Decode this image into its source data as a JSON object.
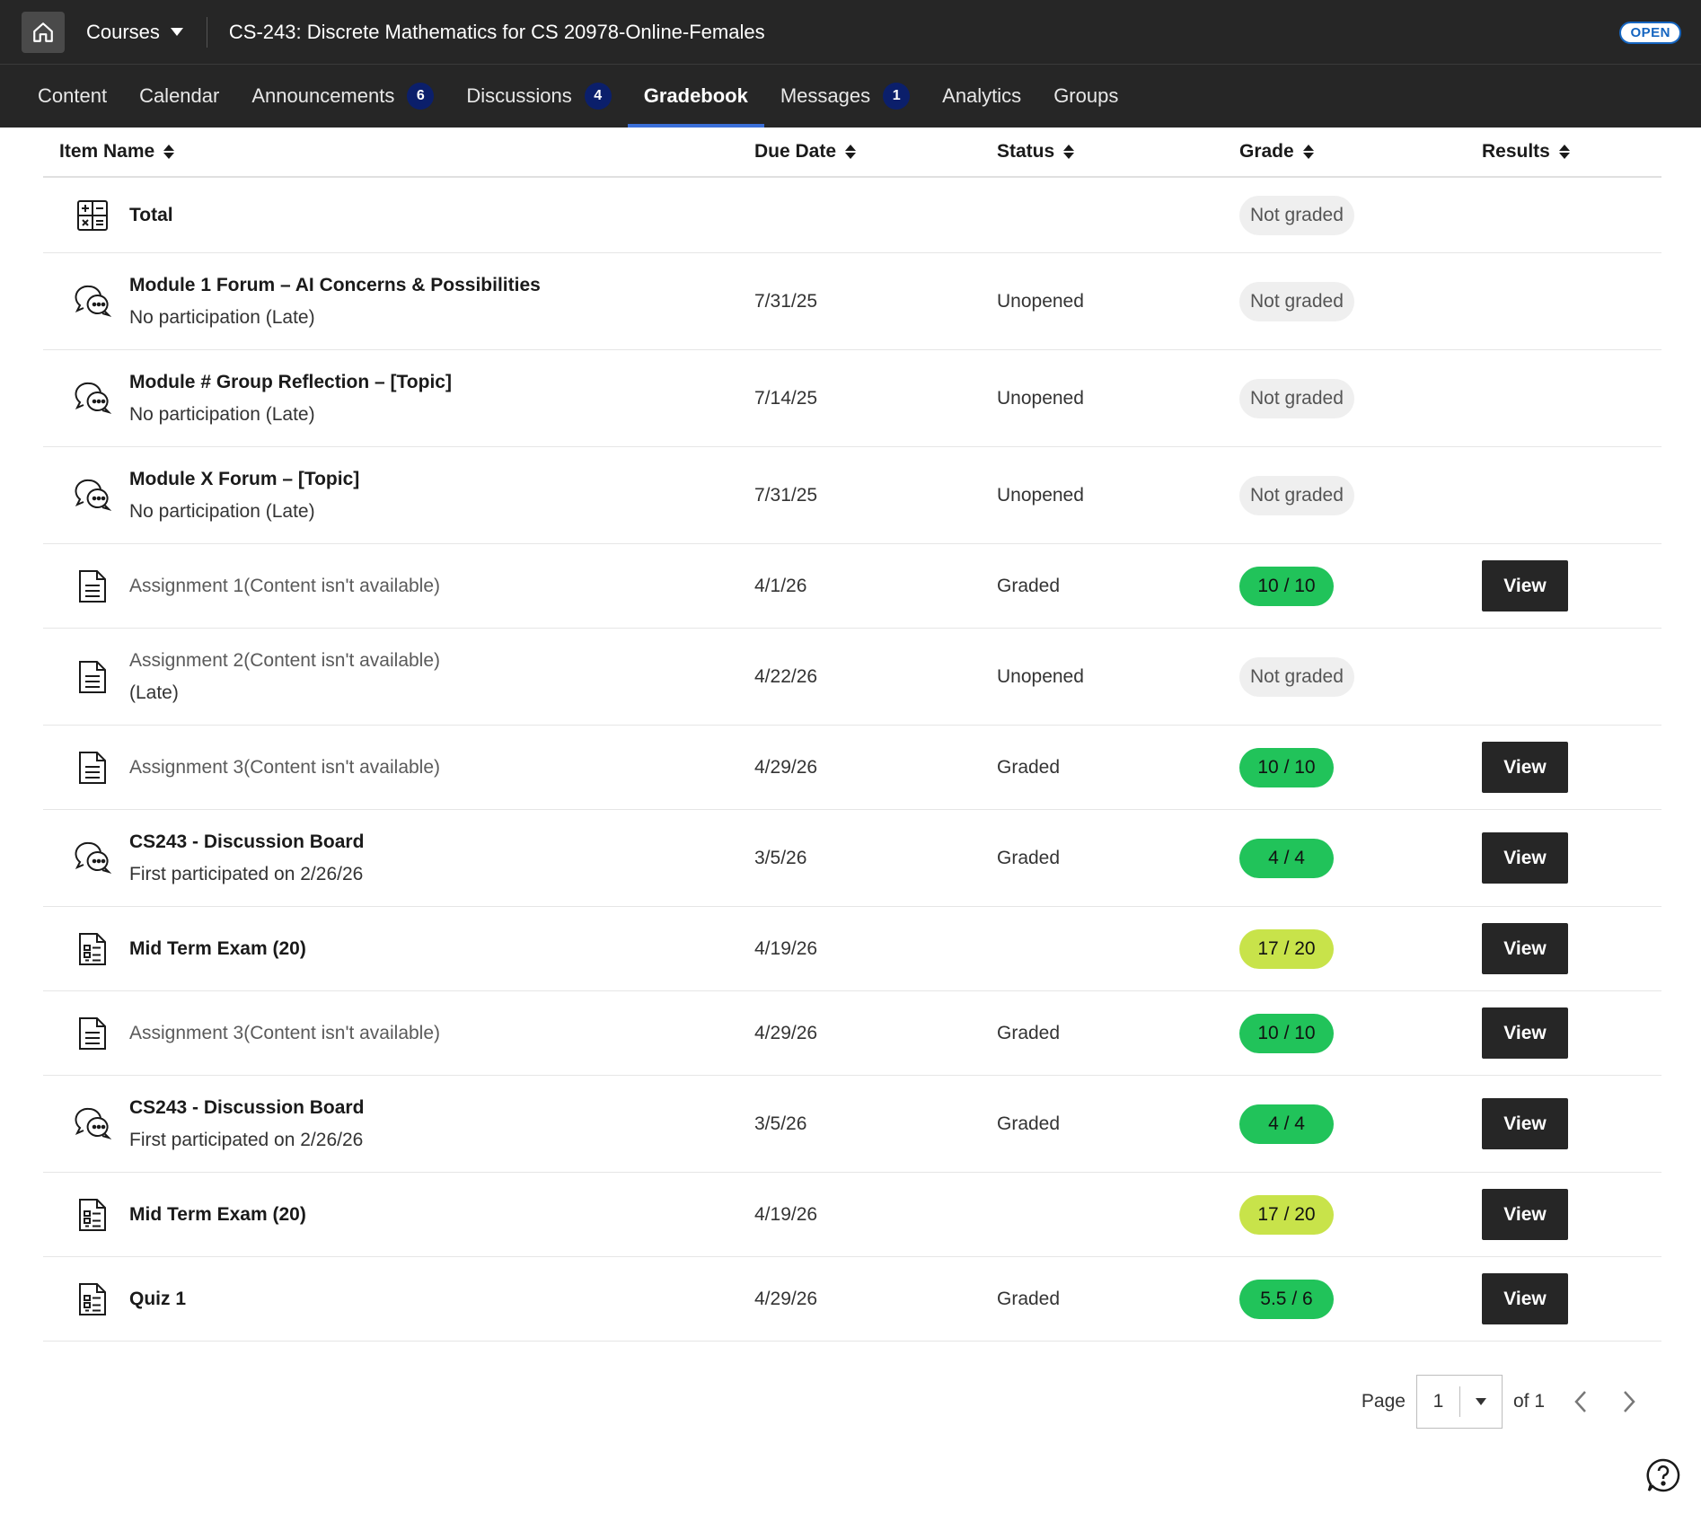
{
  "topbar": {
    "courses_label": "Courses",
    "course_title": "CS-243: Discrete Mathematics for CS 20978-Online-Females",
    "status_badge": "OPEN"
  },
  "nav": {
    "items": [
      {
        "label": "Content",
        "badge": ""
      },
      {
        "label": "Calendar",
        "badge": ""
      },
      {
        "label": "Announcements",
        "badge": "6"
      },
      {
        "label": "Discussions",
        "badge": "4"
      },
      {
        "label": "Gradebook",
        "badge": "",
        "active": true
      },
      {
        "label": "Messages",
        "badge": "1"
      },
      {
        "label": "Analytics",
        "badge": ""
      },
      {
        "label": "Groups",
        "badge": ""
      }
    ]
  },
  "table": {
    "headers": {
      "name": "Item Name",
      "due": "Due Date",
      "status": "Status",
      "grade": "Grade",
      "results": "Results"
    },
    "rows": [
      {
        "icon": "calculator-icon",
        "name": "Total",
        "sub": "",
        "due": "",
        "status": "",
        "grade": "Not graded",
        "grade_type": "ng",
        "view": ""
      },
      {
        "icon": "discussion-icon",
        "name": "Module 1 Forum – AI Concerns & Possibilities",
        "sub": "No participation (Late)",
        "due": "7/31/25",
        "status": "Unopened",
        "grade": "Not graded",
        "grade_type": "ng",
        "view": ""
      },
      {
        "icon": "discussion-icon",
        "name": "Module # Group Reflection – [Topic]",
        "sub": "No participation (Late)",
        "due": "7/14/25",
        "status": "Unopened",
        "grade": "Not graded",
        "grade_type": "ng",
        "view": ""
      },
      {
        "icon": "discussion-icon",
        "name": "Module X Forum – [Topic]",
        "sub": "No participation (Late)",
        "due": "7/31/25",
        "status": "Unopened",
        "grade": "Not graded",
        "grade_type": "ng",
        "view": ""
      },
      {
        "icon": "document-icon",
        "name": "Assignment 1(Content isn't available)",
        "sub": "",
        "due": "4/1/26",
        "status": "Graded",
        "grade": "10 / 10",
        "grade_type": "green",
        "view": "View",
        "link": true
      },
      {
        "icon": "document-icon",
        "name": "Assignment 2(Content isn't available)",
        "sub": "(Late)",
        "due": "4/22/26",
        "status": "Unopened",
        "grade": "Not graded",
        "grade_type": "ng",
        "view": "",
        "link": true
      },
      {
        "icon": "document-icon",
        "name": "Assignment 3(Content isn't available)",
        "sub": "",
        "due": "4/29/26",
        "status": "Graded",
        "grade": "10 / 10",
        "grade_type": "green",
        "view": "View",
        "link": true
      },
      {
        "icon": "discussion-icon",
        "name": "CS243 - Discussion Board",
        "sub": "First participated on 2/26/26",
        "due": "3/5/26",
        "status": "Graded",
        "grade": "4 / 4",
        "grade_type": "green",
        "view": "View"
      },
      {
        "icon": "test-icon",
        "name": "Mid Term Exam (20)",
        "sub": "",
        "due": "4/19/26",
        "status": "",
        "grade": "17 / 20",
        "grade_type": "yellow",
        "view": "View"
      },
      {
        "icon": "document-icon",
        "name": "Assignment 3(Content isn't available)",
        "sub": "",
        "due": "4/29/26",
        "status": "Graded",
        "grade": "10 / 10",
        "grade_type": "green",
        "view": "View",
        "link": true
      },
      {
        "icon": "discussion-icon",
        "name": "CS243 - Discussion Board",
        "sub": "First participated on 2/26/26",
        "due": "3/5/26",
        "status": "Graded",
        "grade": "4 / 4",
        "grade_type": "green",
        "view": "View"
      },
      {
        "icon": "test-icon",
        "name": "Mid Term Exam (20)",
        "sub": "",
        "due": "4/19/26",
        "status": "",
        "grade": "17 / 20",
        "grade_type": "yellow",
        "view": "View"
      },
      {
        "icon": "test-icon",
        "name": "Quiz 1",
        "sub": "",
        "due": "4/29/26",
        "status": "Graded",
        "grade": "5.5 / 6",
        "grade_type": "green",
        "view": "View"
      }
    ]
  },
  "pagination": {
    "page_label": "Page",
    "current_page": "1",
    "of_label": "of 1"
  },
  "colors": {
    "topbar_bg": "#262626",
    "active_underline": "#3b6fd8",
    "nav_badge_bg": "#0b1f6b",
    "grade_full": "#21c35a",
    "grade_partial": "#c8e34a",
    "not_graded_bg": "#efefef"
  }
}
